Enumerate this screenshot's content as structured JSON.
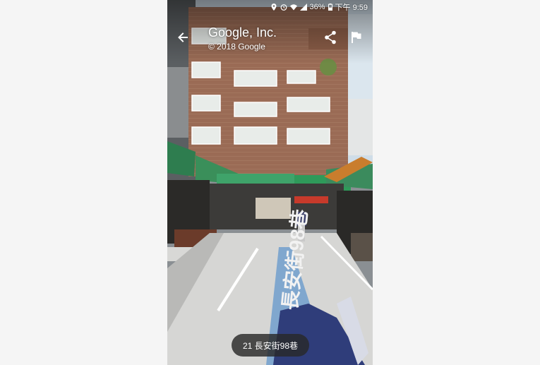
{
  "status_bar": {
    "battery_percent": "36%",
    "time": "下午 9:59",
    "icons": [
      "location-icon",
      "alarm-icon",
      "wifi-icon",
      "signal-icon",
      "battery-icon"
    ]
  },
  "header": {
    "title": "Google, Inc.",
    "copyright": "© 2018 Google",
    "back_icon": "arrow-left-icon",
    "share_icon": "share-icon",
    "flag_icon": "flag-icon"
  },
  "street_view": {
    "road_marking_text": "長安街98巷"
  },
  "address_chip": {
    "label": "21 長安街98巷"
  },
  "colors": {
    "chip_background": "#282828",
    "awning_green": "#2e8b57",
    "sky": "#cfdde8"
  }
}
